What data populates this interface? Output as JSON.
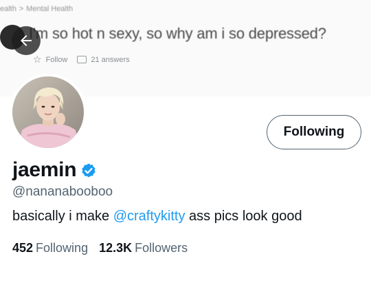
{
  "banner": {
    "breadcrumb": [
      "ealth",
      "Mental Health"
    ],
    "breadcrumb_sep": ">",
    "question": "I'm so hot n sexy, so why am i so depressed?",
    "follow_label": "Follow",
    "answers_label": "21 answers"
  },
  "toolbar": {
    "back_icon": "arrow-left-icon"
  },
  "profile": {
    "display_name": "jaemin",
    "verified": true,
    "handle": "@nananabooboo",
    "bio_before": "basically i make ",
    "bio_mention": "@craftykitty",
    "bio_after": " ass pics look good",
    "follow_button_label": "Following",
    "following_count": "452",
    "following_label": "Following",
    "followers_count": "12.3K",
    "followers_label": "Followers"
  },
  "colors": {
    "accent": "#1d9bf0",
    "text_primary": "#0f1419",
    "text_secondary": "#536471",
    "border": "#536471"
  }
}
